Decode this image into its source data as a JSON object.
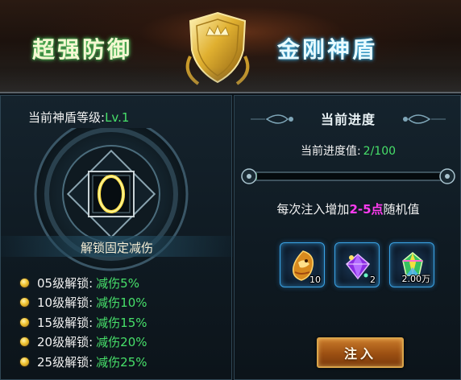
{
  "banner": {
    "title_left": "超强防御",
    "title_right": "金刚神盾",
    "emblem_icon": "golden-shield-crown-icon"
  },
  "left_panel": {
    "level_label": "当前神盾等级:",
    "level_value": "Lv.1",
    "emblem_icon": "golden-ring-emblem-icon",
    "section_title": "解锁固定减伤",
    "unlocks": [
      {
        "label": "05级解锁:",
        "value": "减伤5%"
      },
      {
        "label": "10级解锁:",
        "value": "减伤10%"
      },
      {
        "label": "15级解锁:",
        "value": "减伤15%"
      },
      {
        "label": "20级解锁:",
        "value": "减伤20%"
      },
      {
        "label": "25级解锁:",
        "value": "减伤25%"
      }
    ]
  },
  "right_panel": {
    "title": "当前进度",
    "progress_label": "当前进度值:",
    "progress_value": "2/100",
    "progress_fraction": 0.02,
    "inject_desc_prefix": "每次注入增加",
    "inject_desc_range": "2-5点",
    "inject_desc_suffix": "随机值",
    "items": [
      {
        "icon": "golden-dragon-icon",
        "count": "10"
      },
      {
        "icon": "purple-gem-icon",
        "count": "2"
      },
      {
        "icon": "rainbow-crystal-icon",
        "count": "2.00万"
      }
    ],
    "inject_button": "注入"
  },
  "colors": {
    "green_value": "#47e06a",
    "magenta_range": "#ff3cf0",
    "button_gold": "#d9a44a"
  }
}
